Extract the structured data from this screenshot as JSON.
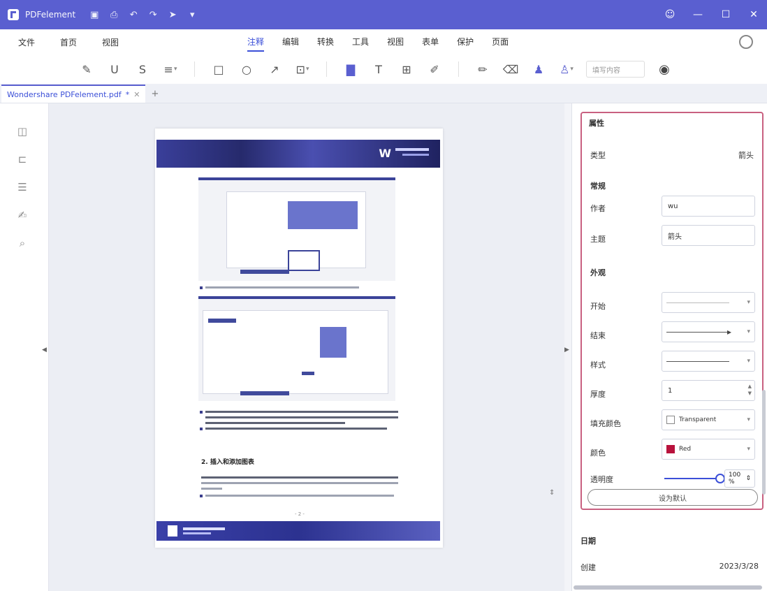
{
  "titlebar": {
    "app_name": "PDFelement",
    "quick_icons": [
      "save-icon",
      "print-icon",
      "undo-icon",
      "redo-icon",
      "share-icon"
    ],
    "controls": [
      "account-icon",
      "minimize-icon",
      "maximize-icon",
      "close-icon"
    ]
  },
  "menu": {
    "left": [
      "文件",
      "首页",
      "视图"
    ],
    "center": [
      "注释",
      "编辑",
      "转换",
      "工具",
      "视图",
      "表单",
      "保护",
      "页面"
    ],
    "active": "注释"
  },
  "toolbar": {
    "search_placeholder": "填写内容",
    "tools": [
      "highlight-icon",
      "underline-icon",
      "strikethrough-icon",
      "text-box-icon",
      "rectangle-icon",
      "circle-icon",
      "arrow-icon",
      "shape-icon",
      "stamp-icon",
      "text-icon",
      "textbox-icon",
      "note-icon",
      "pencil-icon",
      "eraser-icon",
      "stamp2-icon",
      "signature-icon",
      "eye-icon"
    ]
  },
  "tab": {
    "filename": "Wondershare PDFelement.pdf",
    "modified": "*"
  },
  "left_sidebar": [
    "thumbnail-icon",
    "bookmark-icon",
    "list-icon",
    "comment-icon",
    "search-icon"
  ],
  "document": {
    "section_title": "2. 插入和添加图表",
    "page_number": "- 2 -"
  },
  "properties": {
    "title": "属性",
    "type_label": "类型",
    "type_value": "箭头",
    "general_heading": "常规",
    "author_label": "作者",
    "author_value": "wu",
    "subject_label": "主题",
    "subject_value": "箭头",
    "appearance_heading": "外观",
    "start_label": "开始",
    "end_label": "结束",
    "style_label": "样式",
    "thickness_label": "厚度",
    "thickness_value": "1",
    "fill_color_label": "填充颜色",
    "fill_color_value": "Transparent",
    "color_label": "颜色",
    "color_value": "Red",
    "opacity_label": "透明度",
    "opacity_value": "100 %",
    "opacity_fraction": 1.0,
    "set_default_label": "设为默认"
  },
  "metadata": {
    "heading": "日期",
    "date_label": "创建",
    "date_value": "2023/3/28"
  },
  "colors": {
    "titlebar": "#5a5fd0",
    "accent": "#3b4fd8",
    "highlight_border": "#c86080",
    "red_swatch": "#b8123c"
  }
}
